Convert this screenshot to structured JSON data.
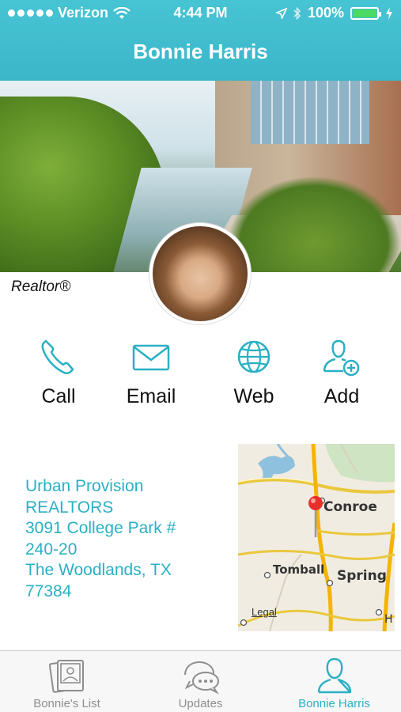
{
  "status_bar": {
    "carrier": "Verizon",
    "time": "4:44 PM",
    "battery": "100%",
    "battery_level": 1.0
  },
  "header": {
    "title": "Bonnie Harris"
  },
  "profile": {
    "role": "Realtor®"
  },
  "actions": [
    {
      "label": "Call",
      "icon": "phone-icon"
    },
    {
      "label": "Email",
      "icon": "envelope-icon"
    },
    {
      "label": "Web",
      "icon": "globe-icon"
    },
    {
      "label": "Add",
      "icon": "add-contact-icon"
    }
  ],
  "address": {
    "line1": "Urban Provision",
    "line2": "REALTORS",
    "line3": "3091 College Park #",
    "line4": "240-20",
    "line5": "The Woodlands, TX",
    "line6": "77384"
  },
  "map": {
    "labels": [
      "Conroe",
      "Tomball",
      "Spring",
      "Legal",
      "H"
    ]
  },
  "tabs": [
    {
      "label": "Bonnie's List",
      "icon": "photos-icon",
      "active": false
    },
    {
      "label": "Updates",
      "icon": "chat-bubbles-icon",
      "active": false
    },
    {
      "label": "Bonnie Harris",
      "icon": "person-icon",
      "active": true
    }
  ],
  "colors": {
    "accent": "#2ab0c4",
    "header": "#3fbccd",
    "battery": "#4cd964"
  }
}
